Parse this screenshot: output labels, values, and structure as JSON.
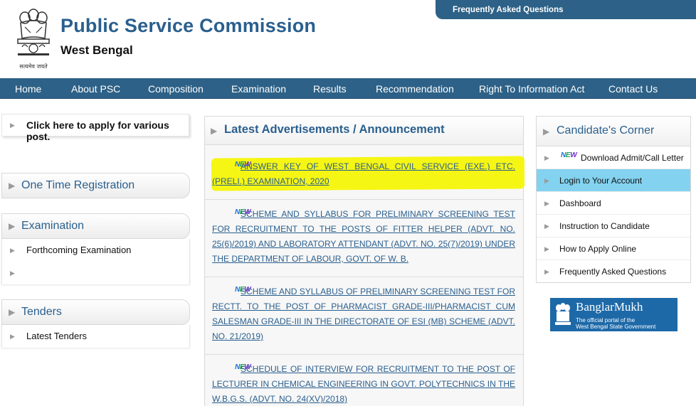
{
  "header": {
    "title": "Public Service Commission",
    "subtitle": "West Bengal",
    "emblem_caption": "सत्यमेव जयते",
    "faq_tab": "Frequently Asked Questions"
  },
  "nav": {
    "items": [
      "Home",
      "About PSC",
      "Composition",
      "Examination",
      "Results",
      "Recommendation",
      "Right To Information Act",
      "Contact Us"
    ]
  },
  "left": {
    "apply": "Click here to apply for various post.",
    "one_time": "One Time Registration",
    "examination": "Examination",
    "exam_items": [
      "Forthcoming Examination",
      ""
    ],
    "tenders": "Tenders",
    "tender_items": [
      "Latest Tenders"
    ]
  },
  "middle": {
    "title": "Latest Advertisements / Announcement",
    "new_label": "NEW",
    "items": [
      "ANSWER KEY OF WEST BENGAL CIVIL SERVICE (EXE.) ETC. (PRELI.) EXAMINATION, 2020",
      "SCHEME AND SYLLABUS FOR PRELIMINARY SCREENING TEST FOR RECRUITMENT TO THE POSTS OF FITTER HELPER (ADVT. NO. 25(6)/2019) AND LABORATORY ATTENDANT (ADVT. NO. 25(7)/2019) UNDER THE DEPARTMENT OF LABOUR, GOVT. OF W. B.",
      "SCHEME AND SYLLABUS OF PRELIMINARY SCREENING TEST FOR RECTT. TO THE POST OF PHARMACIST GRADE-III/PHARMACIST CUM SALESMAN GRADE-III IN THE DIRECTORATE OF ESI (MB) SCHEME (ADVT. NO. 21/2019)",
      "SCHEDULE OF INTERVIEW FOR RECRUITMENT TO THE POST OF LECTURER IN CHEMICAL ENGINEERING IN GOVT. POLYTECHNICS IN THE W.B.G.S. (ADVT. NO. 24(XV)/2018)"
    ],
    "highlight_color": "#f6f614"
  },
  "right": {
    "title": "Candidate's Corner",
    "new_label": "NEW",
    "items": [
      "Download Admit/Call Letter",
      "Login to Your Account",
      "Dashboard",
      "Instruction to Candidate",
      "How to Apply Online",
      "Frequently Asked Questions"
    ],
    "active_color": "#83d2f0"
  },
  "banner": {
    "name": "BanglarMukh",
    "line1": "The official portal of  the",
    "line2": "West Bengal State Government"
  },
  "colors": {
    "nav_bg": "#2d6187",
    "title": "#2a5f8e",
    "link": "#2a5f8e"
  }
}
